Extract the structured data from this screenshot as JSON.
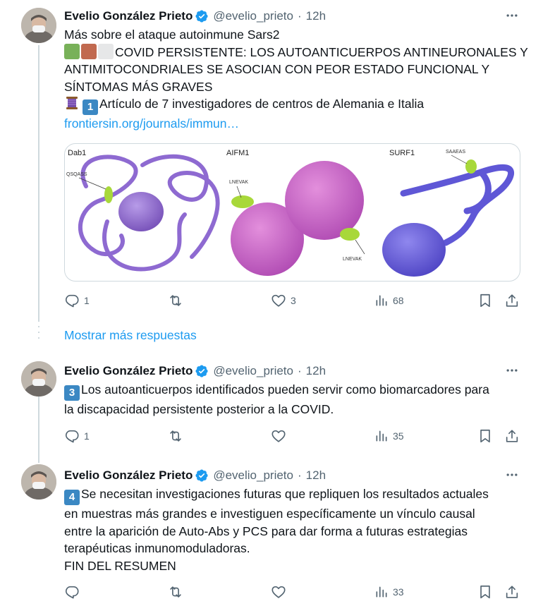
{
  "colors": {
    "text": "#0f1419",
    "secondary": "#536471",
    "link": "#1d9bf0",
    "verified": "#1d9bf0",
    "border": "#cfd9de"
  },
  "tweets": [
    {
      "author_name": "Evelio González Prieto",
      "handle": "@evelio_prieto",
      "time": "12h",
      "lines": [
        "Más sobre el ataque autoinmune Sars2",
        "COVID PERSISTENTE: LOS AUTOANTICUERPOS ANTINEURONALES Y",
        "ANTIMITOCONDRIALES SE ASOCIAN CON PEOR ESTADO FUNCIONAL Y",
        "SÍNTOMAS MÁS GRAVES",
        "Artículo de 7 investigadores de centros de Alemania e Italia"
      ],
      "keycap": "1",
      "link": "frontiersin.org/journals/immun…",
      "media": {
        "panel_titles": [
          "Dab1",
          "AIFM1",
          "SURF1"
        ],
        "epitope_labels": [
          "QSQASS",
          "LNEVAK",
          "LNEVAK",
          "SAAEAS"
        ]
      },
      "replies": "1",
      "retweets": "",
      "likes": "3",
      "views": "68"
    },
    {
      "author_name": "Evelio González Prieto",
      "handle": "@evelio_prieto",
      "time": "12h",
      "keycap": "3",
      "lines": [
        "Los autoanticuerpos identificados pueden servir como biomarcadores para",
        "la discapacidad persistente posterior a la COVID."
      ],
      "replies": "1",
      "retweets": "",
      "likes": "",
      "views": "35"
    },
    {
      "author_name": "Evelio González Prieto",
      "handle": "@evelio_prieto",
      "time": "12h",
      "keycap": "4",
      "lines": [
        "Se necesitan investigaciones futuras que repliquen los resultados actuales",
        "en muestras más grandes e investiguen específicamente un vínculo causal",
        "entre la aparición de Auto-Abs y PCS para dar forma a futuras estrategias",
        "terapéuticas inmunomoduladoras.",
        "FIN DEL RESUMEN"
      ],
      "replies": "",
      "retweets": "",
      "likes": "",
      "views": "33"
    }
  ],
  "show_more_replies": "Mostrar más respuestas",
  "icons": [
    "avatar",
    "verified-badge-icon",
    "more-options-icon",
    "reply-icon",
    "retweet-icon",
    "like-icon",
    "views-icon",
    "bookmark-icon",
    "share-icon",
    "thread-emoji-icon"
  ]
}
